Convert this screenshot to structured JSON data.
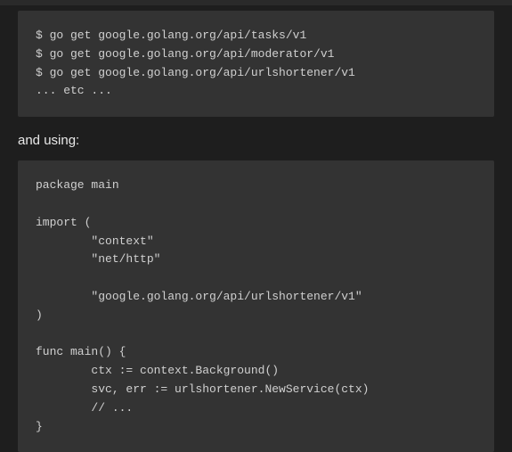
{
  "code_block_1": {
    "lines": [
      "$ go get google.golang.org/api/tasks/v1",
      "$ go get google.golang.org/api/moderator/v1",
      "$ go get google.golang.org/api/urlshortener/v1",
      "... etc ..."
    ]
  },
  "prose_1": "and using:",
  "code_block_2": {
    "lines": [
      "package main",
      "",
      "import (",
      "        \"context\"",
      "        \"net/http\"",
      "",
      "        \"google.golang.org/api/urlshortener/v1\"",
      ")",
      "",
      "func main() {",
      "        ctx := context.Background()",
      "        svc, err := urlshortener.NewService(ctx)",
      "        // ...",
      "}"
    ]
  }
}
